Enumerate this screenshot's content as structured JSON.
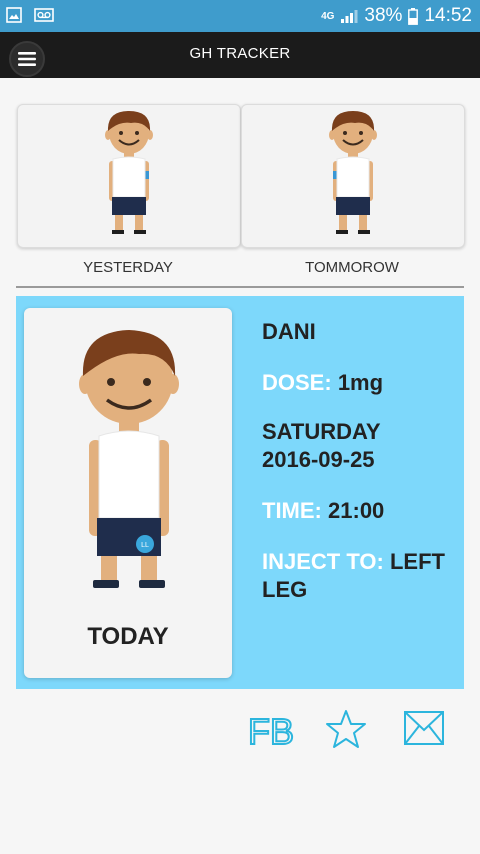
{
  "status_bar": {
    "network": "4G",
    "battery": "38%",
    "time": "14:52"
  },
  "app_bar": {
    "title": "GH TRACKER"
  },
  "days": {
    "yesterday_label": "YESTERDAY",
    "tomorrow_label": "TOMMOROW",
    "today_label": "TODAY"
  },
  "today": {
    "name": "DANI",
    "dose_label": "DOSE:",
    "dose_value": "1mg",
    "day": "SATURDAY",
    "date": "2016-09-25",
    "time_label": "TIME:",
    "time_value": "21:00",
    "inject_label": "INJECT TO:",
    "inject_value": "LEFT LEG",
    "badge": "LL"
  },
  "actions": {
    "fb_label": "FB",
    "icons": [
      "facebook-icon",
      "star-icon",
      "mail-icon"
    ]
  },
  "colors": {
    "status_bar": "#3f9ccc",
    "app_bar": "#1b1b1b",
    "today_panel": "#7dd8fb",
    "accent": "#2cb5dd"
  }
}
